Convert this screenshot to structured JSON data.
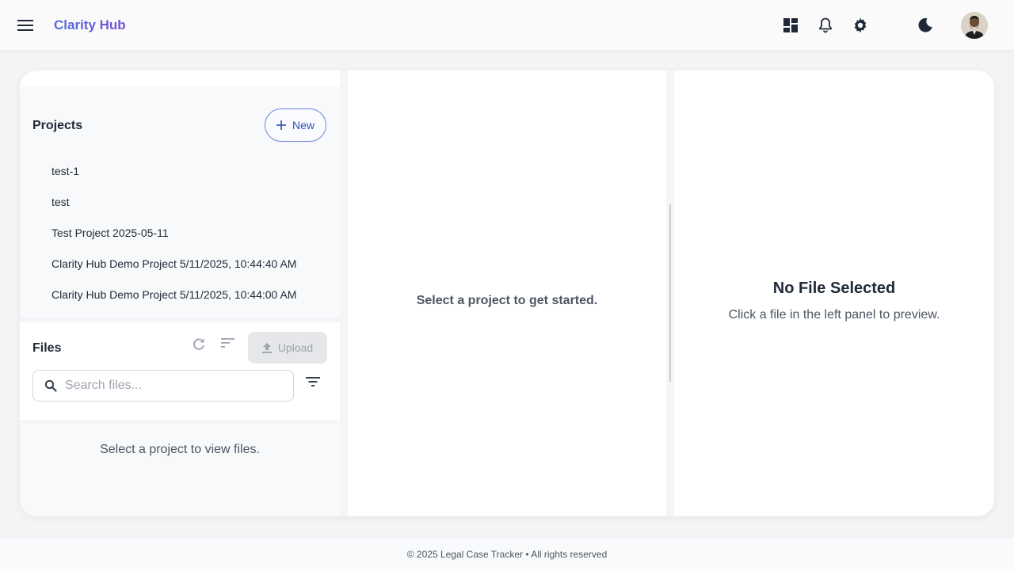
{
  "app": {
    "brand": "Clarity Hub"
  },
  "header": {
    "icons": [
      "menu-icon",
      "dashboard-icon",
      "bell-icon",
      "gear-icon",
      "moon-icon"
    ]
  },
  "projects": {
    "title": "Projects",
    "new_label": "New",
    "items": [
      {
        "label": "test-1"
      },
      {
        "label": "test"
      },
      {
        "label": "Test Project 2025-05-11"
      },
      {
        "label": "Clarity Hub Demo Project 5/11/2025, 10:44:40 AM"
      },
      {
        "label": "Clarity Hub Demo Project 5/11/2025, 10:44:00 AM"
      }
    ]
  },
  "files": {
    "title": "Files",
    "upload_label": "Upload",
    "search_placeholder": "Search files...",
    "empty_message": "Select a project to view files."
  },
  "middle": {
    "message": "Select a project to get started."
  },
  "preview": {
    "title": "No File Selected",
    "subtitle": "Click a file in the left panel to preview."
  },
  "footer": {
    "text": "© 2025 Legal Case Tracker • All rights reserved"
  },
  "colors": {
    "accent": "#5b5bd6",
    "new_button_border": "#6b86d6",
    "text_primary": "#1f2937",
    "text_secondary": "#4b5563"
  }
}
